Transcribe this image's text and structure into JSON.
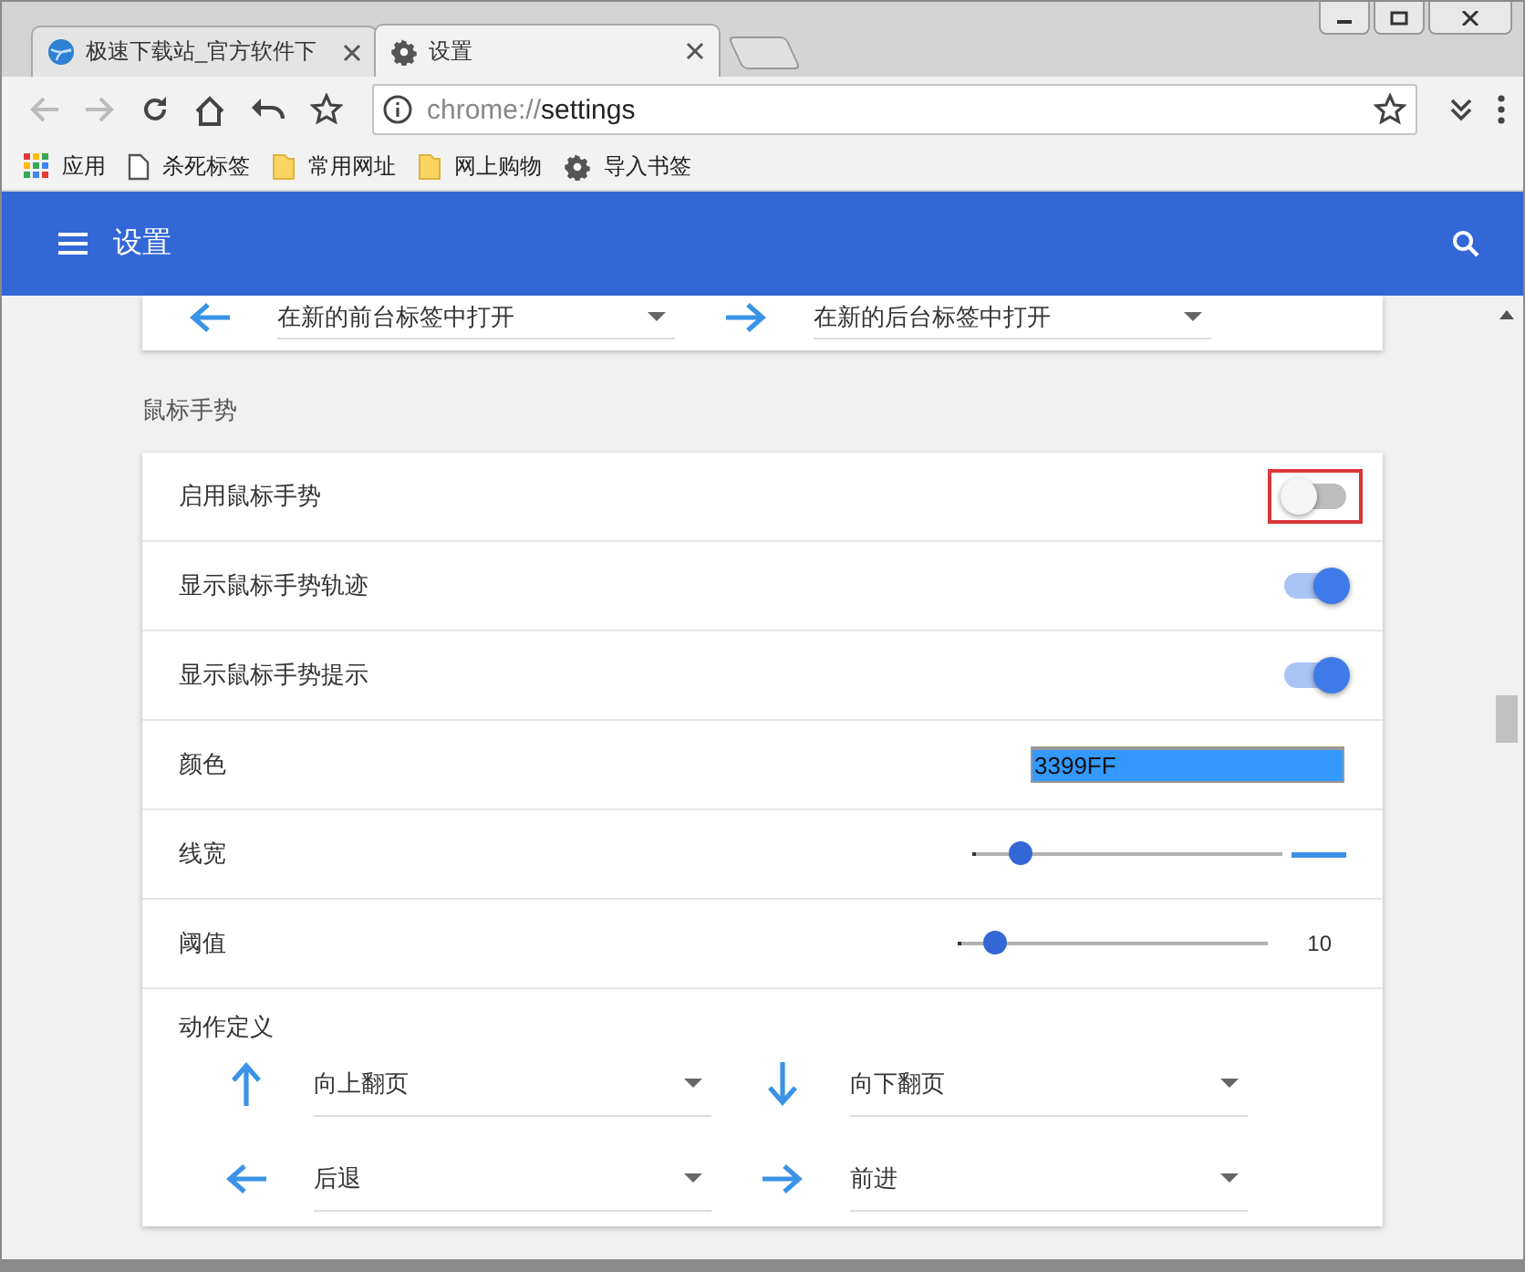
{
  "tabs": [
    {
      "title": "极速下载站_官方软件下",
      "kind": "page",
      "selected": false
    },
    {
      "title": "设置",
      "kind": "settings",
      "selected": true
    }
  ],
  "address": {
    "scheme": "chrome://",
    "path": "settings"
  },
  "bookmarks": [
    {
      "label": "应用",
      "kind": "apps"
    },
    {
      "label": "杀死标签",
      "kind": "page"
    },
    {
      "label": "常用网址",
      "kind": "folder"
    },
    {
      "label": "网上购物",
      "kind": "folder"
    },
    {
      "label": "导入书签",
      "kind": "settings"
    }
  ],
  "header": {
    "title": "设置"
  },
  "top_actions": [
    {
      "kind": "left",
      "value": "在新的前台标签中打开"
    },
    {
      "kind": "right",
      "value": "在新的后台标签中打开"
    }
  ],
  "section": {
    "title": "鼠标手势",
    "rows": [
      {
        "kind": "toggle",
        "label": "启用鼠标手势",
        "on": false,
        "highlighted": true
      },
      {
        "kind": "toggle",
        "label": "显示鼠标手势轨迹",
        "on": true,
        "highlighted": false
      },
      {
        "kind": "toggle",
        "label": "显示鼠标手势提示",
        "on": true,
        "highlighted": false
      },
      {
        "kind": "color",
        "label": "颜色",
        "value": "3399FF"
      },
      {
        "kind": "slider",
        "label": "线宽",
        "level": 0.14
      },
      {
        "kind": "slider",
        "label": "阈值",
        "level": 0.11,
        "reading": "10"
      }
    ],
    "actions": {
      "label": "动作定义",
      "items": [
        {
          "kind": "up",
          "value": "向上翻页"
        },
        {
          "kind": "down",
          "value": "向下翻页"
        },
        {
          "kind": "left",
          "value": "后退"
        },
        {
          "kind": "right",
          "value": "前进"
        }
      ]
    }
  }
}
